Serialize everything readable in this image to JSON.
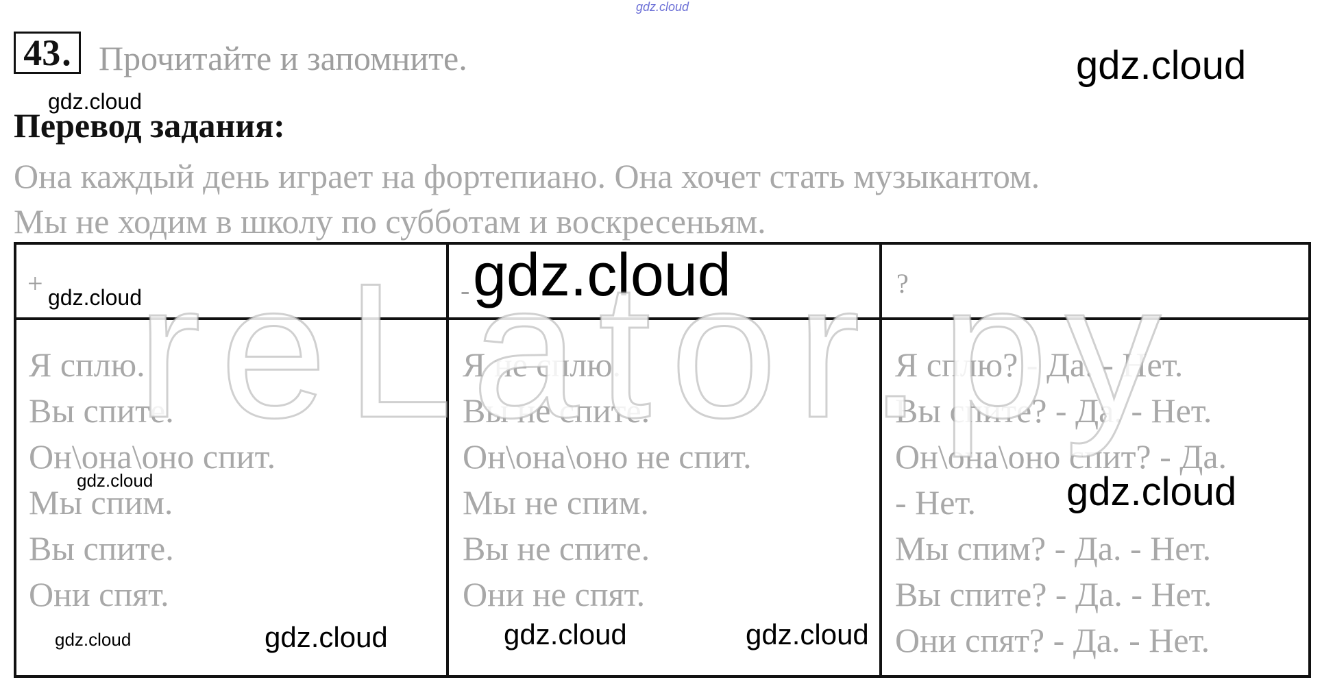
{
  "watermark_top": "gdz.cloud",
  "task": {
    "number": "43",
    "instruction": "Прочитайте и запомните."
  },
  "translation": {
    "heading": "Перевод задания:",
    "lines": [
      "Она каждый день играет на фортепиано. Она хочет стать музыкантом.",
      "Мы не ходим в школу по субботам и воскресеньям."
    ]
  },
  "table": {
    "headers": [
      "+",
      "-",
      "?"
    ],
    "columns": [
      [
        "Я сплю.",
        "Вы спите.",
        "Он\\она\\оно спит.",
        "Мы спим.",
        "Вы спите.",
        "Они спят."
      ],
      [
        "Я не сплю.",
        "Вы не спите.",
        "Он\\она\\оно не спит.",
        "Мы не спим.",
        "Вы не спите.",
        "Они не спят."
      ],
      [
        "Я сплю? - Да. - Нет.",
        "Вы спите? - Да. - Нет.",
        "Он\\она\\оно спит? - Да.",
        "- Нет.",
        "Мы спим? - Да. - Нет.",
        "Вы спите? - Да. - Нет.",
        "Они спят? - Да. - Нет."
      ]
    ]
  },
  "watermarks": {
    "large_header_right": "gdz.cloud",
    "under_number": "gdz.cloud",
    "cell_plus_header": "gdz.cloud",
    "cell_minus_header": "gdz.cloud",
    "col1_middle": "gdz.cloud",
    "col3_middle": "gdz.cloud",
    "bottom_1": "gdz.cloud",
    "bottom_2": "gdz.cloud",
    "bottom_3": "gdz.cloud",
    "bottom_4": "gdz.cloud",
    "overlay": "reLator.ру"
  }
}
